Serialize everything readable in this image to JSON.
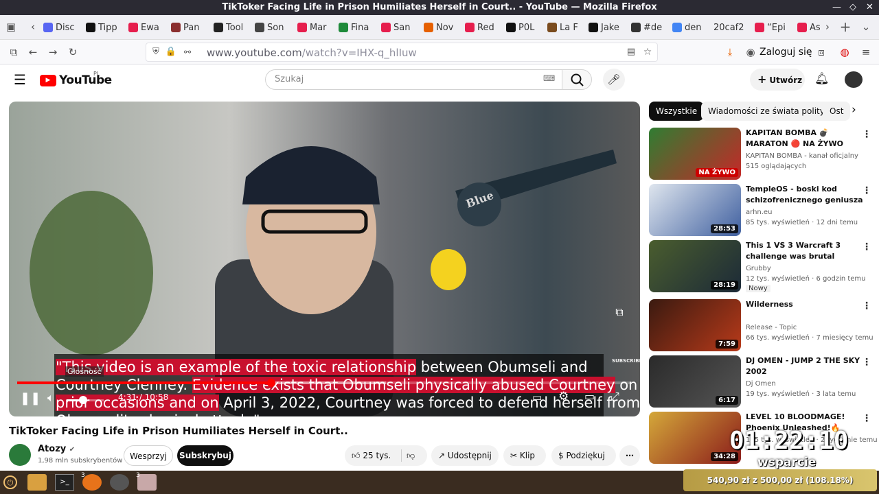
{
  "window": {
    "title": "TikToker Facing Life in Prison Humiliates Herself in Court.. - YouTube — Mozilla Firefox"
  },
  "tabs": [
    {
      "label": "Disc",
      "color": "#5865f2"
    },
    {
      "label": "Tipp",
      "color": "#111"
    },
    {
      "label": "Ewa",
      "color": "#e61e4d"
    },
    {
      "label": "Pan",
      "color": "#8b2f2f"
    },
    {
      "label": "Tool",
      "color": "#222"
    },
    {
      "label": "Son",
      "color": "#444"
    },
    {
      "label": "Mar",
      "color": "#e61e4d"
    },
    {
      "label": "Fina",
      "color": "#1e8a3a"
    },
    {
      "label": "San",
      "color": "#e61e4d"
    },
    {
      "label": "Nov",
      "color": "#e66000"
    },
    {
      "label": "Red",
      "color": "#e61e4d"
    },
    {
      "label": "P0L",
      "color": "#111"
    },
    {
      "label": "La F",
      "color": "#7a4b1e"
    },
    {
      "label": "Jake",
      "color": "#111"
    },
    {
      "label": "#de",
      "color": "#333"
    },
    {
      "label": "den",
      "color": "#4285f4"
    },
    {
      "label": "20caf2",
      "color": "#999"
    },
    {
      "label": "“Epi",
      "color": "#e61e4d"
    },
    {
      "label": "As",
      "color": "#e61e4d"
    }
  ],
  "nav": {
    "url_host": "www.youtube.com",
    "url_path": "/watch?v=IHX-q_hlIuw",
    "login_label": "Zaloguj się"
  },
  "yt": {
    "logo_text": "YouTube",
    "region": "PL",
    "search_placeholder": "Szukaj",
    "create_label": "Utwórz",
    "video": {
      "caption_lines": [
        {
          "hl": "\"This video is an example of the toxic relationship",
          "rest": " between Obumseli and"
        },
        {
          "pre": "Courtney Clenney. ",
          "hl": "Evidence exists that Obumseli physically abused Courtney",
          "rest": " on"
        },
        {
          "hl": "prior occasions and on",
          "rest": " April 3, 2022, Courtney was forced to defend herself from"
        },
        {
          "pre": "Obumseli's physical attack.\"",
          "hl": "",
          "rest": ""
        }
      ],
      "volume_tooltip": "Głośność",
      "time_current": "4:31",
      "time_total": "10:58",
      "progress": 0.413,
      "buffered": 0.6,
      "volume": 0.45,
      "subscribe_watermark": "SUBSCRIBE",
      "overlay_text": "Blue"
    },
    "title": "TikToker Facing Life in Prison Humiliates Herself in Court..",
    "channel": {
      "name": "Atozy",
      "subs": "1,98 mln subskrybentów"
    },
    "actions": {
      "support": "Wesprzyj",
      "subscribe": "Subskrybuj",
      "likes": "25 tys.",
      "share": "Udostępnij",
      "clip": "Klip",
      "thanks": "Podziękuj"
    },
    "chips": [
      "Wszystkie",
      "Wiadomości ze świata polityki",
      "Ost"
    ],
    "recommended": [
      {
        "title": "KAPITAN BOMBA 💣 MARATON 🔴 NA ŻYWO",
        "channel": "KAPITAN BOMBA - kanał oficjalny",
        "meta": "515 oglądających",
        "duration": "NA ŻYWO",
        "live": true,
        "thumb_a": "#2f7d32",
        "thumb_b": "#c62828"
      },
      {
        "title": "TempleOS - boski kod schizofrenicznego geniusza",
        "channel": "arhn.eu",
        "meta": "85 tys. wyświetleń · 12 dni temu",
        "duration": "28:53",
        "thumb_a": "#dfe6ee",
        "thumb_b": "#4060a0"
      },
      {
        "title": "This 1 VS 3 Warcraft 3 challenge was brutal",
        "channel": "Grubby",
        "meta": "12 tys. wyświetleń · 6 godzin temu",
        "badge": "Nowy",
        "duration": "28:19",
        "thumb_a": "#4a5d2e",
        "thumb_b": "#1c2a38"
      },
      {
        "title": "Wilderness",
        "channel": "Release - Topic",
        "meta": "66 tys. wyświetleń · 7 miesięcy temu",
        "duration": "7:59",
        "thumb_a": "#3a1a10",
        "thumb_b": "#b83a1a"
      },
      {
        "title": "DJ OMEN - JUMP 2 THE SKY 2002",
        "channel": "Dj Omen",
        "meta": "19 tys. wyświetleń · 3 lata temu",
        "duration": "6:17",
        "thumb_a": "#2a2a2a",
        "thumb_b": "#555"
      },
      {
        "title": "LEVEL 10 BLOODMAGE! Phoenix Unleashed!🔥",
        "channel": "",
        "meta": "105 tys. wyświetleń · 2 tygodnie temu",
        "duration": "34:28",
        "thumb_a": "#d4a83a",
        "thumb_b": "#8a1a1a"
      }
    ]
  },
  "overlay": {
    "timer": "01:22:10",
    "label": "wsparcie",
    "donation": "540,90 zł z 500,00 zł (108.18%)"
  },
  "taskbar": {
    "badge1": "3",
    "badge2": "3"
  }
}
